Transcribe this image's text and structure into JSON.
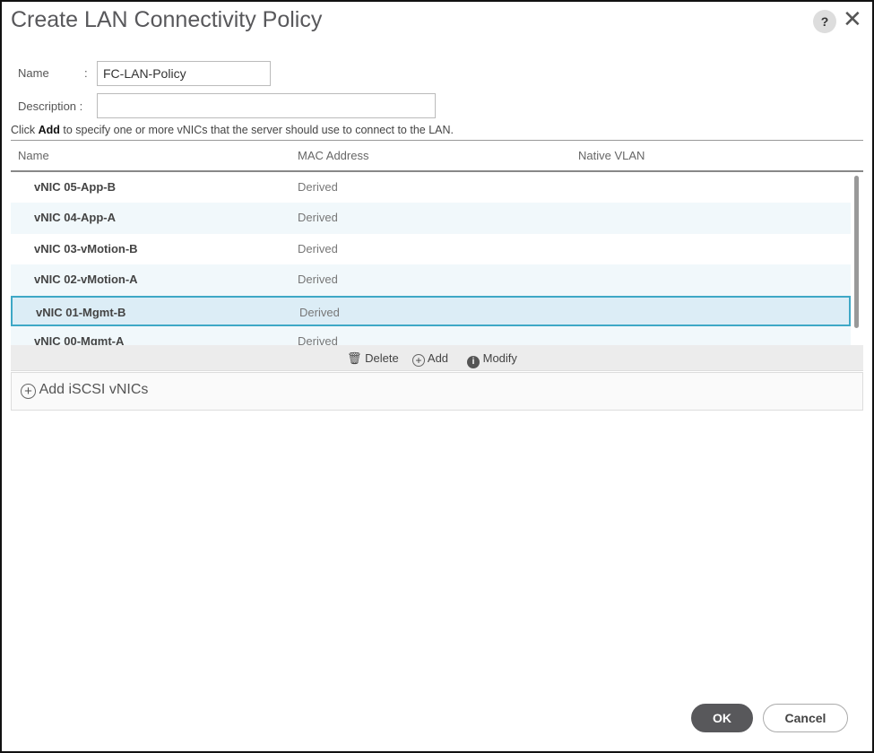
{
  "dialog": {
    "title": "Create LAN Connectivity Policy",
    "help_label": "?",
    "close_label": "✕"
  },
  "form": {
    "name_label": "Name",
    "name_sep": ":",
    "name_value": "FC-LAN-Policy",
    "description_label": "Description :",
    "description_value": ""
  },
  "hint": {
    "prefix": "Click ",
    "bold": "Add",
    "suffix": " to specify one or more vNICs that the server should use to connect to the LAN."
  },
  "table": {
    "columns": [
      "Name",
      "MAC Address",
      "Native VLAN"
    ],
    "rows": [
      {
        "name": "vNIC 05-App-B",
        "mac": "Derived",
        "vlan": ""
      },
      {
        "name": "vNIC 04-App-A",
        "mac": "Derived",
        "vlan": ""
      },
      {
        "name": "vNIC 03-vMotion-B",
        "mac": "Derived",
        "vlan": ""
      },
      {
        "name": "vNIC 02-vMotion-A",
        "mac": "Derived",
        "vlan": ""
      },
      {
        "name": "vNIC 01-Mgmt-B",
        "mac": "Derived",
        "vlan": "",
        "selected": true
      },
      {
        "name": "vNIC 00-Mgmt-A",
        "mac": "Derived",
        "vlan": ""
      }
    ]
  },
  "toolbar": {
    "delete": "Delete",
    "add": "Add",
    "modify": "Modify"
  },
  "iscsi": {
    "label": "Add iSCSI vNICs"
  },
  "footer": {
    "ok": "OK",
    "cancel": "Cancel"
  },
  "colors": {
    "selection_border": "#3ea8c6",
    "selection_bg": "#dcedf6",
    "ok_bg": "#58585b"
  }
}
